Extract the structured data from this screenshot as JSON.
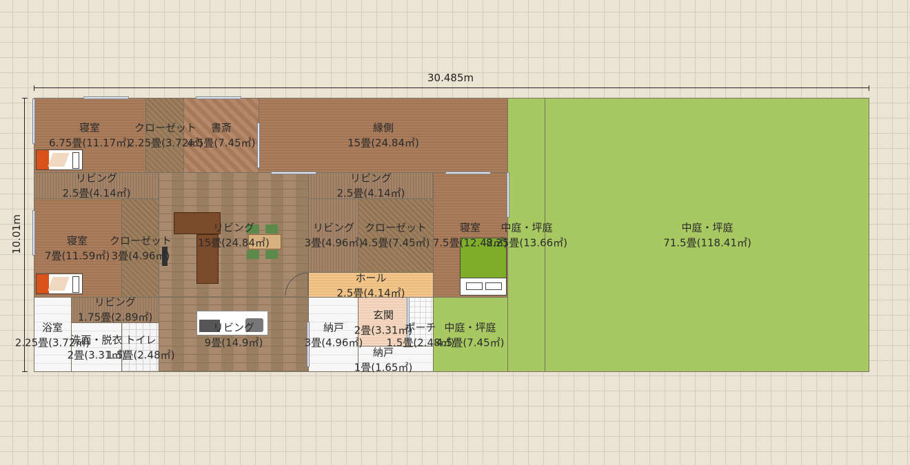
{
  "dimensions": {
    "width": "30.485m",
    "height": "10.01m"
  },
  "rooms": [
    {
      "name": "寝室",
      "area": "6.75畳(11.17㎡)"
    },
    {
      "name": "クローゼット",
      "area": "2.25畳(3.72㎡)"
    },
    {
      "name": "書斎",
      "area": "4.5畳(7.45㎡)"
    },
    {
      "name": "縁側",
      "area": "15畳(24.84㎡)"
    },
    {
      "name": "リビング",
      "area": "2.5畳(4.14㎡)"
    },
    {
      "name": "リビング",
      "area": "2.5畳(4.14㎡)"
    },
    {
      "name": "寝室",
      "area": "7畳(11.59㎡)"
    },
    {
      "name": "クローゼット",
      "area": "3畳(4.96㎡)"
    },
    {
      "name": "リビング",
      "area": "15畳(24.84㎡)"
    },
    {
      "name": "リビング",
      "area": "3畳(4.96㎡)"
    },
    {
      "name": "クローゼット",
      "area": "4.5畳(7.45㎡)"
    },
    {
      "name": "寝室",
      "area": "7.5畳(12.42㎡)"
    },
    {
      "name": "中庭・坪庭",
      "area": "8.25畳(13.66㎡)"
    },
    {
      "name": "中庭・坪庭",
      "area": "71.5畳(118.41㎡)"
    },
    {
      "name": "ホール",
      "area": "2.5畳(4.14㎡)"
    },
    {
      "name": "リビング",
      "area": "1.75畳(2.89㎡)"
    },
    {
      "name": "浴室",
      "area": "2.25畳(3.72㎡)"
    },
    {
      "name": "洗面・脱衣",
      "area": "2畳(3.31㎡)"
    },
    {
      "name": "トイレ",
      "area": "1.5畳(2.48㎡)"
    },
    {
      "name": "リビング",
      "area": "9畳(14.9㎡)"
    },
    {
      "name": "納戸",
      "area": "3畳(4.96㎡)"
    },
    {
      "name": "玄関",
      "area": "2畳(3.31㎡)"
    },
    {
      "name": "ポーチ",
      "area": "1.5畳(2.48㎡)"
    },
    {
      "name": "納戸",
      "area": "1畳(1.65㎡)"
    },
    {
      "name": "中庭・坪庭",
      "area": "4.5畳(7.45㎡)"
    }
  ],
  "colors": {
    "garden": "#a8c862",
    "background": "#ebe3d3",
    "wall": "#7a7060"
  }
}
